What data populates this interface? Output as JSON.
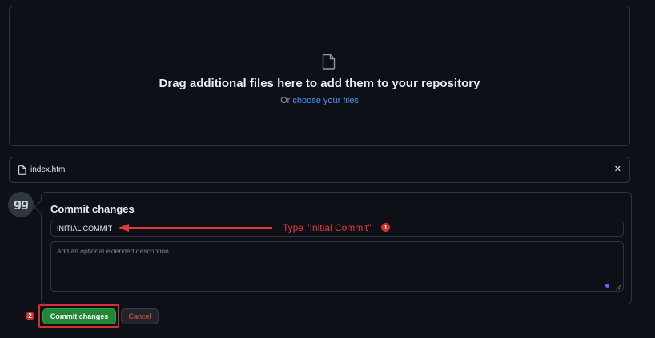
{
  "dropzone": {
    "icon": "file-icon",
    "title": "Drag additional files here to add them to your repository",
    "subtitle_prefix": "Or ",
    "subtitle_link": "choose your files"
  },
  "file": {
    "icon": "file-icon",
    "name": "index.html",
    "remove_icon": "close-icon",
    "remove_label": "✕"
  },
  "avatar": {
    "glyph": "gg"
  },
  "commit": {
    "title": "Commit changes",
    "summary_value": "INITIAL COMMIT",
    "description_placeholder": "Add an optional extended description...",
    "commit_button": "Commit changes",
    "cancel_button": "Cancel"
  },
  "annotations": {
    "step1_text": "Type \"Initial Commit\"",
    "step1_badge": "1",
    "step2_badge": "2",
    "color": "#e5383b"
  },
  "colors": {
    "background": "#0d1117",
    "border": "#30363d",
    "link": "#4493f8",
    "primary_button": "#238636",
    "danger_text": "#f85149"
  }
}
